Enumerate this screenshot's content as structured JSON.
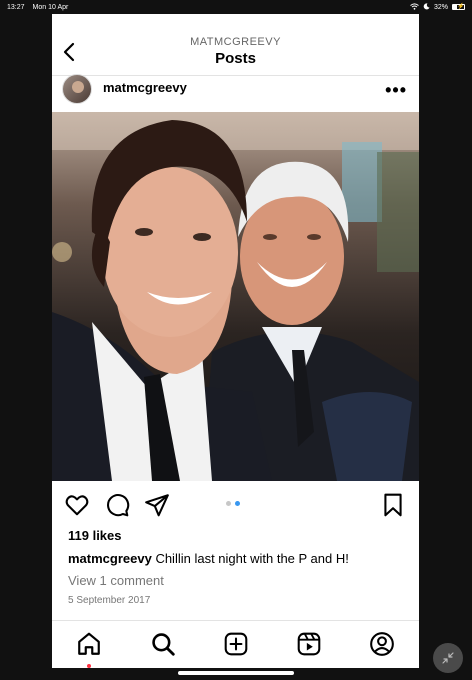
{
  "status": {
    "time": "13:27",
    "date": "Mon 10 Apr",
    "battery": "32%",
    "battery_level": 0.32
  },
  "header": {
    "username": "MATMCGREEVY",
    "title": "Posts"
  },
  "post": {
    "author": "matmcgreevy",
    "likes": "119 likes",
    "caption_user": "matmcgreevy",
    "caption_text": " Chillin last night with the P and H!",
    "view_comments": "View 1 comment",
    "date": "5 September 2017",
    "carousel": {
      "count": 2,
      "active_index": 1
    }
  },
  "icons": {
    "back": "chevron-left-icon",
    "more": "more-dots-icon",
    "like": "heart-icon",
    "comment": "comment-icon",
    "share": "send-icon",
    "save": "bookmark-icon",
    "home": "home-icon",
    "search": "search-icon",
    "create": "plus-square-icon",
    "reels": "reels-icon",
    "profile": "profile-icon"
  },
  "colors": {
    "accent": "#3897f0",
    "notification": "#ff3040",
    "frame": "#111111"
  }
}
